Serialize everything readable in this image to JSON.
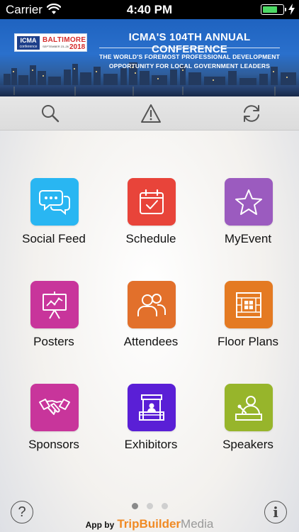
{
  "status_bar": {
    "carrier": "Carrier",
    "time": "4:40 PM",
    "battery_level": 0.75,
    "battery_color": "#4cd964"
  },
  "banner": {
    "logo_org": "ICMA",
    "logo_org_sub": "conference",
    "logo_city": "BALTIMORE",
    "logo_year": "2018",
    "logo_dates": "SEPTEMBER 23–26",
    "title": "ICMA'S 104TH ANNUAL CONFERENCE",
    "subtitle_line1": "THE WORLD'S FOREMOST PROFESSIONAL DEVELOPMENT",
    "subtitle_line2": "OPPORTUNITY FOR LOCAL GOVERNMENT LEADERS"
  },
  "toolbar": {
    "search_icon": "search-icon",
    "alert_icon": "warning-icon",
    "refresh_icon": "refresh-icon"
  },
  "menu": [
    {
      "label": "Social Feed",
      "icon": "chat-bubbles-icon",
      "color": "#29b6f2"
    },
    {
      "label": "Schedule",
      "icon": "calendar-check-icon",
      "color": "#e8443a"
    },
    {
      "label": "MyEvent",
      "icon": "star-icon",
      "color": "#9b5bbf"
    },
    {
      "label": "Posters",
      "icon": "presentation-chart-icon",
      "color": "#c8359b"
    },
    {
      "label": "Attendees",
      "icon": "people-icon",
      "color": "#e2702b"
    },
    {
      "label": "Floor Plans",
      "icon": "floor-plan-icon",
      "color": "#e47a22"
    },
    {
      "label": "Sponsors",
      "icon": "handshake-icon",
      "color": "#c8359b"
    },
    {
      "label": "Exhibitors",
      "icon": "booth-icon",
      "color": "#5a1fd6"
    },
    {
      "label": "Speakers",
      "icon": "speaker-icon",
      "color": "#97b52b"
    }
  ],
  "pagination": {
    "current_page": 1,
    "total_pages": 3
  },
  "footer": {
    "credit_prefix": "App by",
    "brand_part1": "TripBuilder",
    "brand_part2": "Media",
    "help_label": "?",
    "info_label": "i"
  }
}
